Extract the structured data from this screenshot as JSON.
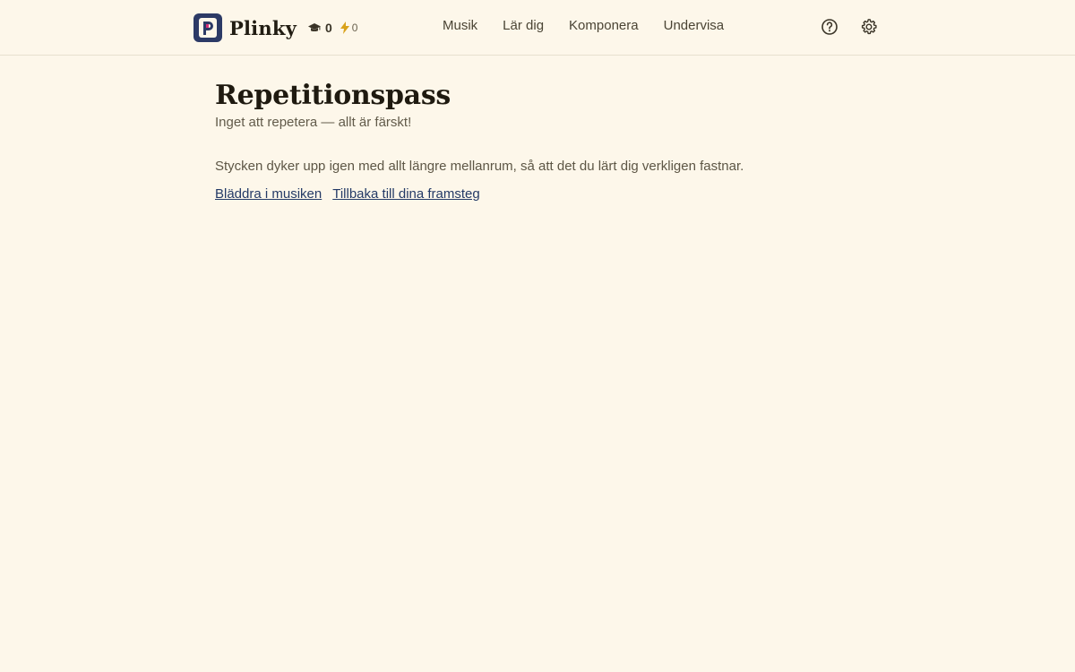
{
  "header": {
    "brand_name": "Plinky",
    "logo_letter": "P",
    "stats": {
      "score": "0",
      "streak": "0"
    },
    "nav": [
      {
        "label": "Musik"
      },
      {
        "label": "Lär dig"
      },
      {
        "label": "Komponera"
      },
      {
        "label": "Undervisa"
      }
    ],
    "icons": {
      "help": "help-circle-icon",
      "settings": "gear-icon",
      "score": "graduation-cap-icon",
      "streak": "lightning-icon"
    }
  },
  "main": {
    "title": "Repetitionspass",
    "subtitle": "Inget att repetera — allt är färskt!",
    "description": "Stycken dyker upp igen med allt längre mellanrum, så att det du lärt dig verkligen fastnar.",
    "links": [
      {
        "label": "Bläddra i musiken"
      },
      {
        "label": "Tillbaka till dina framsteg"
      }
    ]
  },
  "colors": {
    "background": "#fdf7ea",
    "logo_bg": "#2c3a66",
    "logo_accent": "#d8307a",
    "link": "#243a66"
  }
}
